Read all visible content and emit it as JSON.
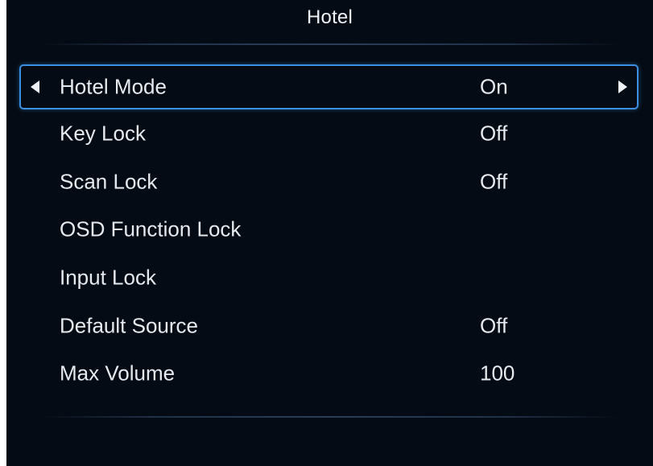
{
  "menu": {
    "title": "Hotel",
    "items": [
      {
        "label": "Hotel Mode",
        "value": "On"
      },
      {
        "label": "Key Lock",
        "value": "Off"
      },
      {
        "label": "Scan Lock",
        "value": "Off"
      },
      {
        "label": "OSD Function Lock",
        "value": ""
      },
      {
        "label": "Input Lock",
        "value": ""
      },
      {
        "label": "Default Source",
        "value": "Off"
      },
      {
        "label": "Max Volume",
        "value": "100"
      }
    ]
  },
  "colors": {
    "background": "#050b14",
    "text": "#e6e9ee",
    "selection_border": "#3a8fe0"
  },
  "icons": {
    "left": "triangle-left-icon",
    "right": "triangle-right-icon"
  }
}
